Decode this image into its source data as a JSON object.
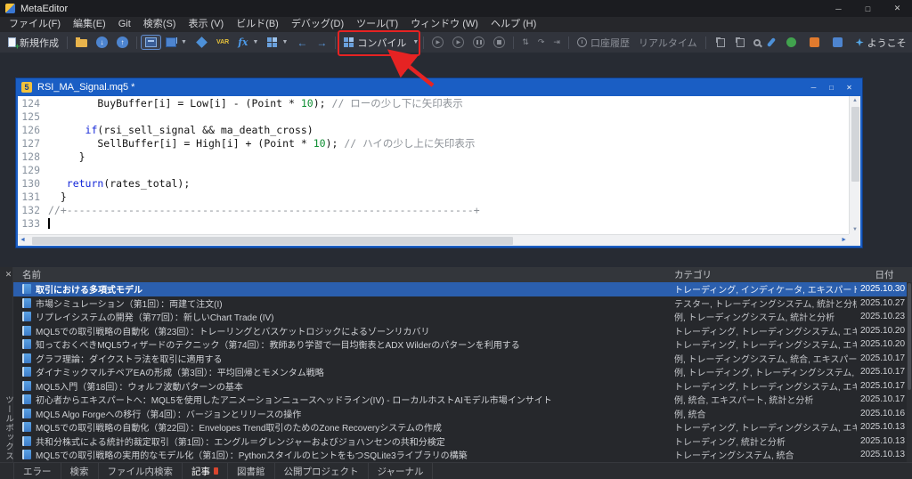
{
  "app": {
    "title": "MetaEditor",
    "menu": [
      {
        "id": "file",
        "label": "ファイル(F)"
      },
      {
        "id": "edit",
        "label": "編集(E)"
      },
      {
        "id": "git",
        "label": "Git"
      },
      {
        "id": "search",
        "label": "検索(S)"
      },
      {
        "id": "view",
        "label": "表示 (V)"
      },
      {
        "id": "build",
        "label": "ビルド(B)"
      },
      {
        "id": "debug",
        "label": "デバッグ(D)"
      },
      {
        "id": "tools",
        "label": "ツール(T)"
      },
      {
        "id": "window",
        "label": "ウィンドウ (W)"
      },
      {
        "id": "help",
        "label": "ヘルプ (H)"
      }
    ]
  },
  "toolbar": {
    "new_label": "新規作成",
    "compile_label": "コンパイル",
    "var_icon_text": "VAR",
    "fx_icon_text": "fx",
    "account_history_label": "口座履歴",
    "realtime_label": "リアルタイム",
    "welcome_label": "ようこそ"
  },
  "editor": {
    "icon_text": "5",
    "title": "RSI_MA_Signal.mq5 *",
    "lines": [
      {
        "num": "124",
        "segs": [
          [
            "p",
            "        BuyBuffer[i] = Low[i] - (Point * "
          ],
          [
            "n",
            "10"
          ],
          [
            "p",
            "); "
          ],
          [
            "c",
            "// ローの少し下に矢印表示"
          ]
        ]
      },
      {
        "num": "125",
        "segs": []
      },
      {
        "num": "126",
        "segs": [
          [
            "p",
            "      "
          ],
          [
            "k",
            "if"
          ],
          [
            "p",
            "(rsi_sell_signal && ma_death_cross)"
          ]
        ]
      },
      {
        "num": "127",
        "segs": [
          [
            "p",
            "        SellBuffer[i] = High[i] + (Point * "
          ],
          [
            "n",
            "10"
          ],
          [
            "p",
            "); "
          ],
          [
            "c",
            "// ハイの少し上に矢印表示"
          ]
        ]
      },
      {
        "num": "128",
        "segs": [
          [
            "p",
            "     }"
          ]
        ]
      },
      {
        "num": "129",
        "segs": []
      },
      {
        "num": "130",
        "segs": [
          [
            "p",
            "   "
          ],
          [
            "k",
            "return"
          ],
          [
            "p",
            "(rates_total);"
          ]
        ]
      },
      {
        "num": "131",
        "segs": [
          [
            "p",
            "  }"
          ]
        ]
      },
      {
        "num": "132",
        "segs": [
          [
            "c",
            "//+------------------------------------------------------------------+"
          ]
        ]
      },
      {
        "num": "133",
        "segs": [],
        "cursor": true
      }
    ]
  },
  "articles": {
    "columns": [
      "名前",
      "カテゴリ",
      "日付"
    ],
    "rows": [
      {
        "name": "取引における多項式モデル",
        "category": "トレーディング, インディケータ, エキスパート",
        "date": "2025.10.30",
        "selected": true
      },
      {
        "name": "市場シミュレーション（第1回）：両建て注文(I)",
        "category": "テスター, トレーディングシステム, 統計と分析",
        "date": "2025.10.27"
      },
      {
        "name": "リプレイシステムの開発（第77回）：新しいChart Trade (IV)",
        "category": "例, トレーディングシステム, 統計と分析",
        "date": "2025.10.23"
      },
      {
        "name": "MQL5での取引戦略の自動化（第23回）：トレーリングとバスケットロジックによるゾーンリカバリ",
        "category": "トレーディング, トレーディングシステム, エキスパートアドバイザー, エキスパート",
        "date": "2025.10.20"
      },
      {
        "name": "知っておくべきMQL5ウィザードのテクニック（第74回）：教師あり学習で一目均衡表とADX Wilderのパターンを利用する",
        "category": "トレーディング, トレーディングシステム, エキスパートアドバイザー, 機械学習",
        "date": "2025.10.20"
      },
      {
        "name": "グラフ理論：ダイクストラ法を取引に適用する",
        "category": "例, トレーディングシステム, 統合, エキスパート",
        "date": "2025.10.17"
      },
      {
        "name": "ダイナミックマルチペアEAの形成（第3回）：平均回帰とモメンタム戦略",
        "category": "例, トレーディング, トレーディングシステム, エキスパート",
        "date": "2025.10.17"
      },
      {
        "name": "MQL5入門（第18回）：ウォルフ波動パターンの基本",
        "category": "トレーディング, トレーディングシステム, エキスパートアドバイザー, エキスパート",
        "date": "2025.10.17"
      },
      {
        "name": "初心者からエキスパートへ：MQL5を使用したアニメーションニュースヘッドライン(IV) - ローカルホストAIモデル市場インサイト",
        "category": "例, 統合, エキスパート, 統計と分析",
        "date": "2025.10.17"
      },
      {
        "name": "MQL5 Algo Forgeへの移行（第4回）：バージョンとリリースの操作",
        "category": "例, 統合",
        "date": "2025.10.16"
      },
      {
        "name": "MQL5での取引戦略の自動化（第22回）：Envelopes Trend取引のためのZone Recoveryシステムの作成",
        "category": "トレーディング, トレーディングシステム, エキスパートアドバイザー, エキスパート",
        "date": "2025.10.13"
      },
      {
        "name": "共和分株式による統計的裁定取引（第1回）：エングル＝グレンジャーおよびジョハンセンの共和分検定",
        "category": "トレーディング, 統計と分析",
        "date": "2025.10.13"
      },
      {
        "name": "MQL5での取引戦略の実用的なモデル化（第1回）：PythonスタイルのヒントをもつSQLite3ライブラリの構築",
        "category": "トレーディングシステム, 統合",
        "date": "2025.10.13"
      }
    ]
  },
  "bottom_tabs": [
    {
      "id": "errors",
      "label": "エラー"
    },
    {
      "id": "search",
      "label": "検索"
    },
    {
      "id": "search-in-files",
      "label": "ファイル内検索"
    },
    {
      "id": "articles",
      "label": "記事",
      "active": true
    },
    {
      "id": "library",
      "label": "図書館"
    },
    {
      "id": "public-projects",
      "label": "公開プロジェクト"
    },
    {
      "id": "journal",
      "label": "ジャーナル"
    }
  ],
  "panel": {
    "side_label": "ツールボックス"
  },
  "colors": {
    "annotation_red": "#e62323",
    "selection_blue": "#2b5fae",
    "editor_titlebar_blue": "#1a5ec4"
  }
}
